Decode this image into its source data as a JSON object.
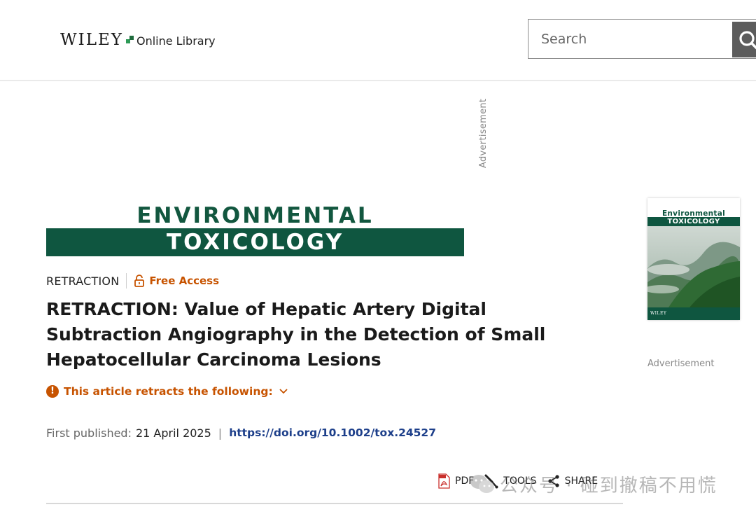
{
  "header": {
    "logo_wiley": "WILEY",
    "logo_online_library": "Online Library",
    "search_placeholder": "Search"
  },
  "ad_vertical_label": "Advertisement",
  "journal_banner": {
    "line1": "ENVIRONMENTAL",
    "line2": "TOXICOLOGY"
  },
  "article": {
    "type": "RETRACTION",
    "access": "Free Access",
    "title": "RETRACTION: Value of Hepatic Artery Digital Subtraction Angiography in the Detection of Small Hepatocellular Carcinoma Lesions",
    "retracts_label": "This article retracts the following:",
    "published_label": "First published:",
    "published_date": "21 April 2025",
    "separator": "|",
    "doi": "https://doi.org/10.1002/tox.24527"
  },
  "toolbar": {
    "pdf": "PDF",
    "tools": "TOOLS",
    "share": "SHARE"
  },
  "watermark": {
    "text": "公众号 · 碰到撤稿不用慌"
  },
  "cover": {
    "title1": "Environmental",
    "title2": "TOXICOLOGY",
    "publisher": "WILEY"
  },
  "sidebar_ad_label": "Advertisement",
  "colors": {
    "journal_green": "#0f5640",
    "access_orange": "#c75300",
    "doi_blue": "#1d3f8a"
  }
}
